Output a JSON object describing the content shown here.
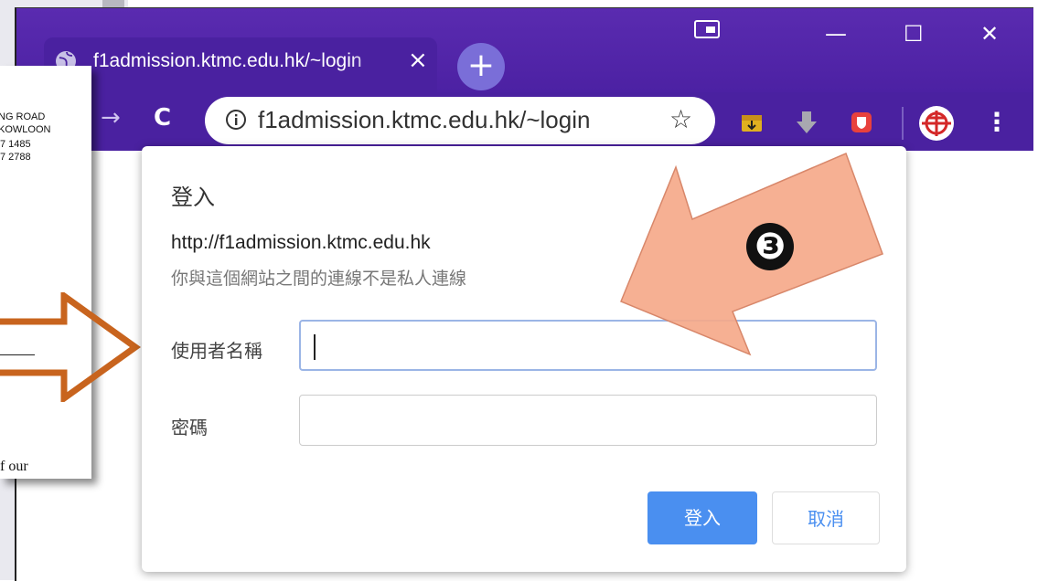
{
  "browser": {
    "tab_title": "f1admission.ktmc.edu.hk/~login",
    "tab_close": "×",
    "new_tab": "+",
    "minimize": "—",
    "maximize": "☐",
    "close": "✕",
    "back": "→",
    "reload": "C",
    "address": "f1admission.ktmc.edu.hk/~login",
    "bookmark_star": "☆",
    "menu": "⋮",
    "accent_color": "#4a21a0"
  },
  "document": {
    "lines": [
      "NG ROAD",
      "KOWLOON",
      "7 1485",
      "7 2788"
    ],
    "footer_text": "f our"
  },
  "dialog": {
    "title": "登入",
    "url": "http://f1admission.ktmc.edu.hk",
    "warning": "你與這個網站之間的連線不是私人連線",
    "username_label": "使用者名稱",
    "username_value": "",
    "password_label": "密碼",
    "password_value": "",
    "login_button": "登入",
    "cancel_button": "取消"
  },
  "annotation": {
    "step_number": "❸"
  }
}
